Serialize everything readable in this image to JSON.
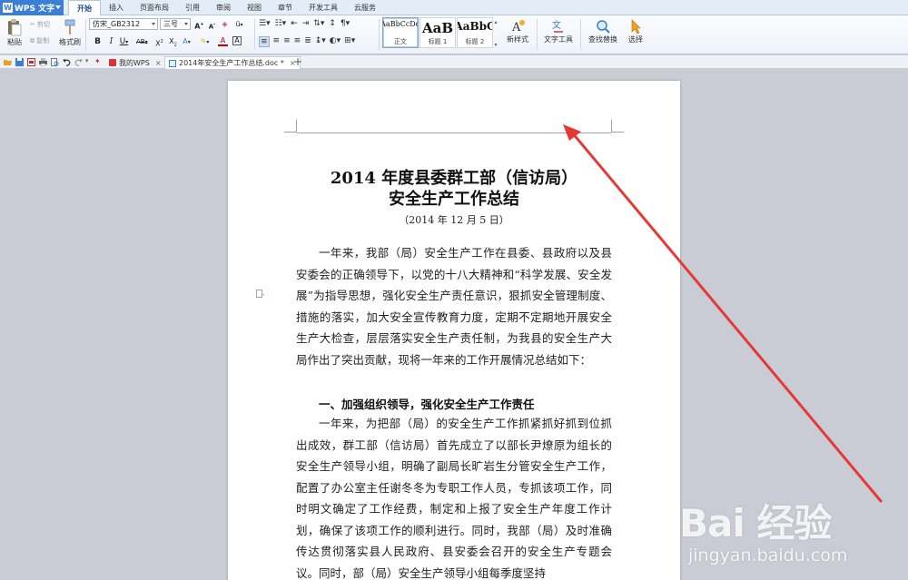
{
  "app": {
    "name": "WPS 文字",
    "logo_letter": "W",
    "accent": "#3a7fd5"
  },
  "menu": {
    "tabs": [
      "开始",
      "插入",
      "页面布局",
      "引用",
      "审阅",
      "视图",
      "章节",
      "开发工具",
      "云服务"
    ],
    "active": "开始"
  },
  "ribbon": {
    "paste_label": "粘贴",
    "cut_label": "剪切",
    "copy_label": "复制",
    "format_painter_label": "格式刷",
    "font_name": "仿宋_GB2312",
    "font_size": "三号",
    "styles": [
      {
        "sample": "AaBbCcDd",
        "label": "正文",
        "selected": true
      },
      {
        "sample": "AaB",
        "label": "标题 1",
        "selected": false
      },
      {
        "sample": "AaBbC",
        "label": "标题 2",
        "selected": false
      }
    ],
    "new_style_label": "新样式",
    "text_tools_label": "文字工具",
    "find_replace_label": "查找替换",
    "select_label": "选择"
  },
  "tabbar": {
    "tabs": [
      {
        "label": "我的WPS",
        "active": false
      },
      {
        "label": "2014年安全生产工作总结.doc *",
        "active": true
      }
    ],
    "add_label": "+"
  },
  "document": {
    "title_line1": "2014 年度县委群工部（信访局）",
    "title_line2": "安全生产工作总结",
    "date": "（2014 年 12 月 5 日）",
    "para1": "一年来，我部（局）安全生产工作在县委、县政府以及县安委会的正确领导下，以党的十八大精神和“科学发展、安全发展”为指导思想，强化安全生产责任意识，狠抓安全管理制度、措施的落实，加大安全宣传教育力度，定期不定期地开展安全生产大检查，层层落实安全生产责任制，为我县的安全生产大局作出了突出贡献，现将一年来的工作开展情况总结如下：",
    "heading1": "一、加强组织领导，强化安全生产工作责任",
    "para2": "一年来，为把部（局）的安全生产工作抓紧抓好抓到位抓出成效，群工部（信访局）首先成立了以部长尹燎原为组长的安全生产领导小组，明确了副局长旷岩生分管安全生产工作，配置了办公室主任谢冬冬为专职工作人员，专抓该项工作，同时明文确定了工作经费，制定和上报了安全生产年度工作计划，确保了该项工作的顺利进行。同时，我部（局）及时准确传达贯彻落实县人民政府、县安委会召开的安全生产专题会议。同时，部（局）安全生产领导小组每季度坚持"
  },
  "annotation": {
    "arrow_color": "#e53935"
  },
  "watermark": {
    "logo": "Bai 经验",
    "url": "jingyan.baidu.com"
  }
}
